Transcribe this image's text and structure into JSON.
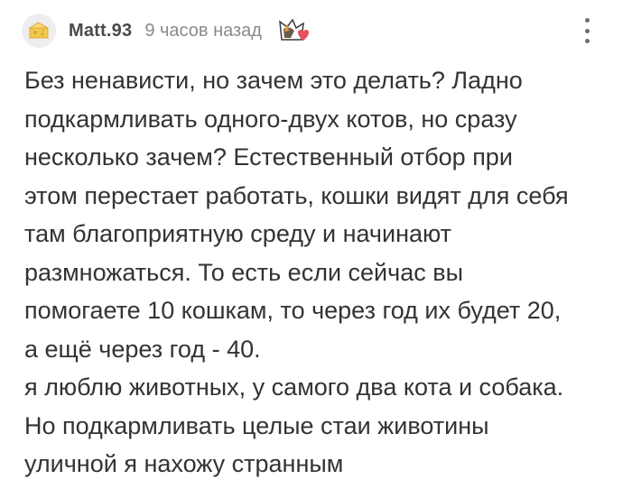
{
  "comment": {
    "author": "Matt.93",
    "time": "9 часов назад",
    "avatar_icon": "cheese-avatar-icon",
    "badge_icon": "cat-heart-badge-icon",
    "menu_icon": "more-vertical-icon",
    "lines": [
      "Без ненависти, но зачем это делать? Ладно",
      "подкармливать одного-двух котов, но сразу",
      "несколько зачем? Естественный отбор при",
      "этом перестает работать, кошки видят для себя",
      "там благоприятную среду и начинают",
      "размножаться. То есть если сейчас вы",
      "помогаете 10 кошкам, то через год их будет 20,",
      "а ещё через год - 40.",
      "я люблю животных, у самого два кота и собака.",
      "Но подкармливать целые стаи животины",
      "уличной я нахожу странным"
    ]
  },
  "colors": {
    "text": "#333333",
    "meta": "#8b8b8b",
    "heart": "#e8505b"
  }
}
